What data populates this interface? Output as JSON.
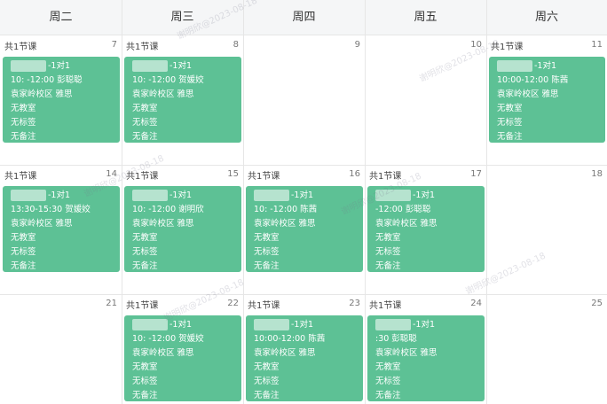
{
  "weekdays": [
    "周二",
    "周三",
    "周四",
    "周五",
    "周六"
  ],
  "rows": [
    {
      "days": [
        {
          "num": "7",
          "count": "共1节课",
          "lesson": {
            "title": "-1对1",
            "time_teacher": "10:  -12:00 彭聪聪",
            "campus_subject": "袁家岭校区   雅思",
            "room": "无教室",
            "tag": "无标签",
            "note": "无备注"
          }
        },
        {
          "num": "8",
          "count": "共1节课",
          "lesson": {
            "title": "-1对1",
            "time_teacher": "10:  -12:00 贺媛姣",
            "campus_subject": "袁家岭校区   雅思",
            "room": "无教室",
            "tag": "无标签",
            "note": "无备注"
          }
        },
        {
          "num": "9",
          "count": "",
          "lesson": null
        },
        {
          "num": "10",
          "count": "",
          "lesson": null
        },
        {
          "num": "11",
          "count": "共1节课",
          "lesson": {
            "title": "-1对1",
            "time_teacher": "10:00-12:00 陈茜",
            "campus_subject": "袁家岭校区   雅思",
            "room": "无教室",
            "tag": "无标签",
            "note": "无备注"
          }
        }
      ]
    },
    {
      "days": [
        {
          "num": "14",
          "count": "共1节课",
          "lesson": {
            "title": "-1对1",
            "time_teacher": "13:30-15:30 贺媛姣",
            "campus_subject": "袁家岭校区   雅思",
            "room": "无教室",
            "tag": "无标签",
            "note": "无备注"
          }
        },
        {
          "num": "15",
          "count": "共1节课",
          "lesson": {
            "title": "-1对1",
            "time_teacher": "10:  -12:00 谢明欣",
            "campus_subject": "袁家岭校区   雅思",
            "room": "无教室",
            "tag": "无标签",
            "note": "无备注"
          }
        },
        {
          "num": "16",
          "count": "共1节课",
          "lesson": {
            "title": "-1对1",
            "time_teacher": "10:  -12:00 陈茜",
            "campus_subject": "袁家岭校区   雅思",
            "room": "无教室",
            "tag": "无标签",
            "note": "无备注"
          }
        },
        {
          "num": "17",
          "count": "共1节课",
          "lesson": {
            "title": "-1对1",
            "time_teacher": "-12:00 彭聪聪",
            "campus_subject": "袁家岭校区   雅思",
            "room": "无教室",
            "tag": "无标签",
            "note": "无备注"
          }
        },
        {
          "num": "18",
          "count": "",
          "lesson": null
        }
      ]
    },
    {
      "days": [
        {
          "num": "21",
          "count": "",
          "lesson": null
        },
        {
          "num": "22",
          "count": "共1节课",
          "lesson": {
            "title": "-1对1",
            "time_teacher": "10:  -12:00 贺媛姣",
            "campus_subject": "袁家岭校区   雅思",
            "room": "无教室",
            "tag": "无标签",
            "note": "无备注"
          }
        },
        {
          "num": "23",
          "count": "共1节课",
          "lesson": {
            "title": "-1对1",
            "time_teacher": "10:00-12:00 陈茜",
            "campus_subject": "袁家岭校区   雅思",
            "room": "无教室",
            "tag": "无标签",
            "note": "无备注"
          }
        },
        {
          "num": "24",
          "count": "共1节课",
          "lesson": {
            "title": "-1对1",
            "time_teacher": ":30 彭聪聪",
            "campus_subject": "袁家岭校区   雅思",
            "room": "无教室",
            "tag": "无标签",
            "note": "无备注"
          }
        },
        {
          "num": "25",
          "count": "",
          "lesson": null
        }
      ]
    }
  ],
  "watermark": "谢明欣@2023-08-18"
}
